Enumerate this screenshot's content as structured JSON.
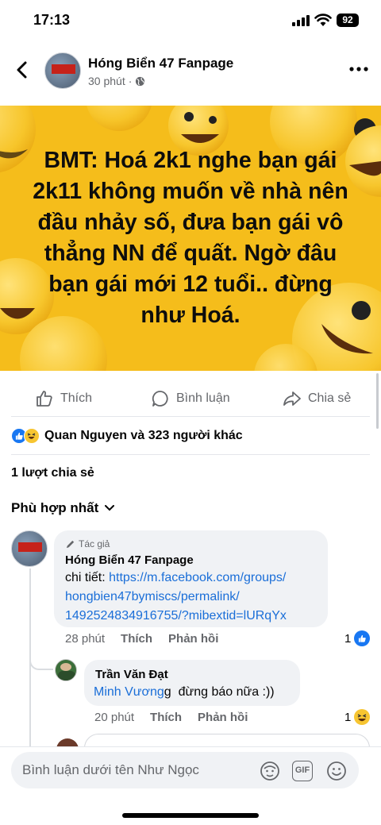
{
  "status": {
    "time": "17:13",
    "battery": "92"
  },
  "header": {
    "page_name": "Hóng Biển 47 Fanpage",
    "time_ago": "30 phút",
    "dot": "·"
  },
  "post": {
    "image_text": "BMT: Hoá 2k1 nghe bạn gái 2k11 không muốn về nhà nên đầu nhảy số, đưa bạn gái vô thẳng NN để quất. Ngờ đâu bạn gái mới 12 tuổi..  đừng như Hoá."
  },
  "actions": {
    "like": "Thích",
    "comment": "Bình luận",
    "share": "Chia sẻ"
  },
  "reactions": {
    "summary": "Quan Nguyen và 323 người khác"
  },
  "shares": {
    "label": "1 lượt chia sẻ"
  },
  "sort": {
    "label": "Phù hợp nhất"
  },
  "comments": [
    {
      "author_tag": "Tác giả",
      "name": "Hóng Biển 47 Fanpage",
      "text_prefix": "chi tiết: ",
      "link_line1": "https://m.facebook.com/groups/",
      "link_line2": "hongbien47bymiscs/permalink/",
      "link_line3": "1492524834916755/?mibextid=lURqYx",
      "time": "28 phút",
      "like": "Thích",
      "reply": "Phản hồi",
      "reaction_count": "1"
    },
    {
      "name": "Trần Văn Đạt",
      "mention": "Minh Vương",
      "text": "g  đừng báo nữa :))",
      "time": "20 phút",
      "like": "Thích",
      "reply": "Phản hồi",
      "reaction_count": "1"
    }
  ],
  "composer": {
    "placeholder": "Bình luận dưới tên Như Ngọc",
    "gif": "GIF"
  },
  "colors": {
    "accent": "#1877f2",
    "image_bg": "#f5bd1b",
    "link": "#1a6ed8",
    "muted": "#65676b"
  }
}
